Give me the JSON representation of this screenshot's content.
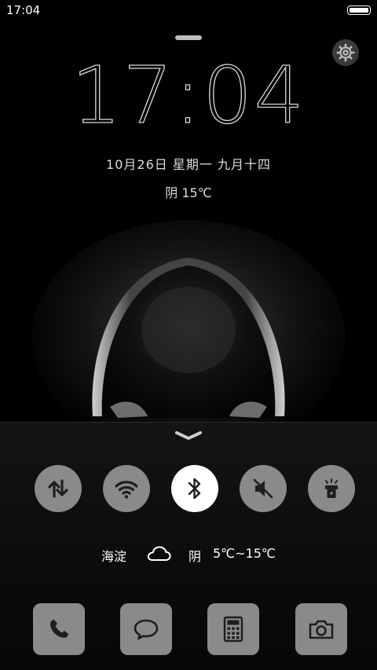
{
  "status_bar": {
    "time": "17:04",
    "battery_icon": "battery-icon"
  },
  "lockscreen": {
    "clock": "17:04",
    "date": "10月26日 星期一 九月十四",
    "weather": "阴 15℃",
    "settings_icon": "gear-icon"
  },
  "quick_toggles": [
    {
      "name": "data",
      "icon": "mobile-data-icon",
      "active": false
    },
    {
      "name": "wifi",
      "icon": "wifi-icon",
      "active": false
    },
    {
      "name": "bluetooth",
      "icon": "bluetooth-icon",
      "active": true
    },
    {
      "name": "mute",
      "icon": "mute-icon",
      "active": false
    },
    {
      "name": "flashlight",
      "icon": "flashlight-icon",
      "active": false
    }
  ],
  "weather_row": {
    "location": "海淀",
    "condition_icon": "cloud-icon",
    "condition": "阴",
    "range": "5℃~15℃"
  },
  "dock": [
    {
      "name": "phone",
      "icon": "phone-icon"
    },
    {
      "name": "messages",
      "icon": "message-icon"
    },
    {
      "name": "calculator",
      "icon": "calculator-icon"
    },
    {
      "name": "camera",
      "icon": "camera-icon"
    }
  ]
}
